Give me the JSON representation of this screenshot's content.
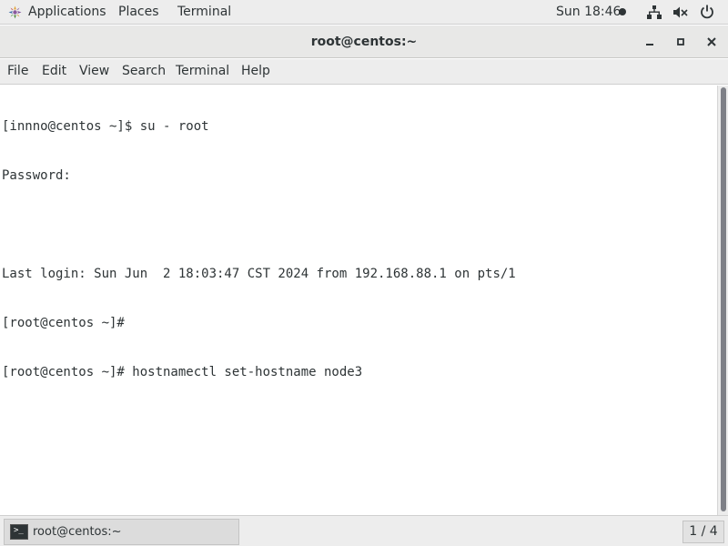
{
  "topbar": {
    "applications_label": "Applications",
    "places_label": "Places",
    "terminal_label": "Terminal",
    "clock": "Sun 18:46",
    "icons": [
      "applications-icon",
      "network-icon",
      "volume-icon",
      "power-icon"
    ]
  },
  "window": {
    "title": "root@centos:~",
    "controls": [
      "minimize-icon",
      "maximize-icon",
      "close-icon"
    ]
  },
  "menubar": {
    "file": "File",
    "edit": "Edit",
    "view": "View",
    "search": "Search",
    "terminal": "Terminal",
    "help": "Help"
  },
  "terminal": {
    "lines": [
      "[innno@centos ~]$ su - root",
      "Password:",
      "",
      "Last login: Sun Jun  2 18:03:47 CST 2024 from 192.168.88.1 on pts/1",
      "[root@centos ~]#",
      "[root@centos ~]# hostnamectl set-hostname node3"
    ]
  },
  "taskbar": {
    "task_label": "root@centos:~",
    "workspace": "1 / 4"
  },
  "colors": {
    "panel_bg": "#ededed",
    "text": "#2e3436",
    "terminal_bg": "#ffffff"
  }
}
